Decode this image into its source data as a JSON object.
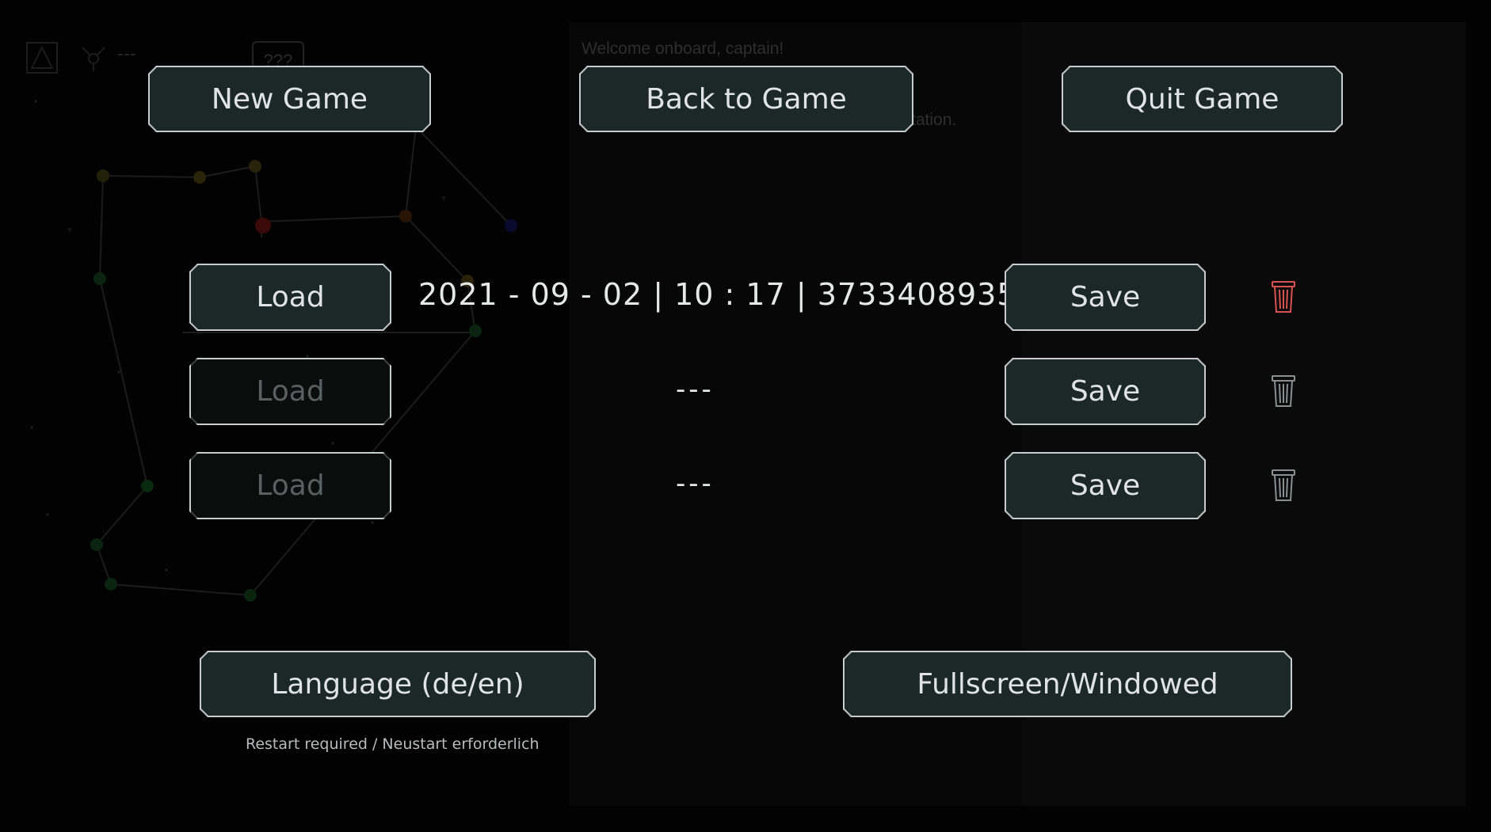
{
  "background": {
    "welcome_text": "Welcome onboard, captain!",
    "station_text": "tation.",
    "unknown_label": "???",
    "dash_label": "---"
  },
  "menu": {
    "new_game_label": "New Game",
    "back_to_game_label": "Back to Game",
    "quit_game_label": "Quit Game",
    "language_label": "Language (de/en)",
    "fullscreen_label": "Fullscreen/Windowed",
    "restart_hint": "Restart required / Neustart erforderlich"
  },
  "save_slots": [
    {
      "load_label": "Load",
      "load_enabled": true,
      "info": "2021 - 09 - 02  |  10 : 17  |  3733408935",
      "save_label": "Save",
      "delete_icon": "trash-icon",
      "delete_color": "#d9534f"
    },
    {
      "load_label": "Load",
      "load_enabled": false,
      "info": "---",
      "save_label": "Save",
      "delete_icon": "trash-icon",
      "delete_color": "#8a8f8f"
    },
    {
      "load_label": "Load",
      "load_enabled": false,
      "info": "---",
      "save_label": "Save",
      "delete_icon": "trash-icon",
      "delete_color": "#8a8f8f"
    }
  ],
  "colors": {
    "button_fill": "#1c2728",
    "button_border": "#c7cccc",
    "text": "#dfe3e3",
    "danger": "#d9534f"
  }
}
